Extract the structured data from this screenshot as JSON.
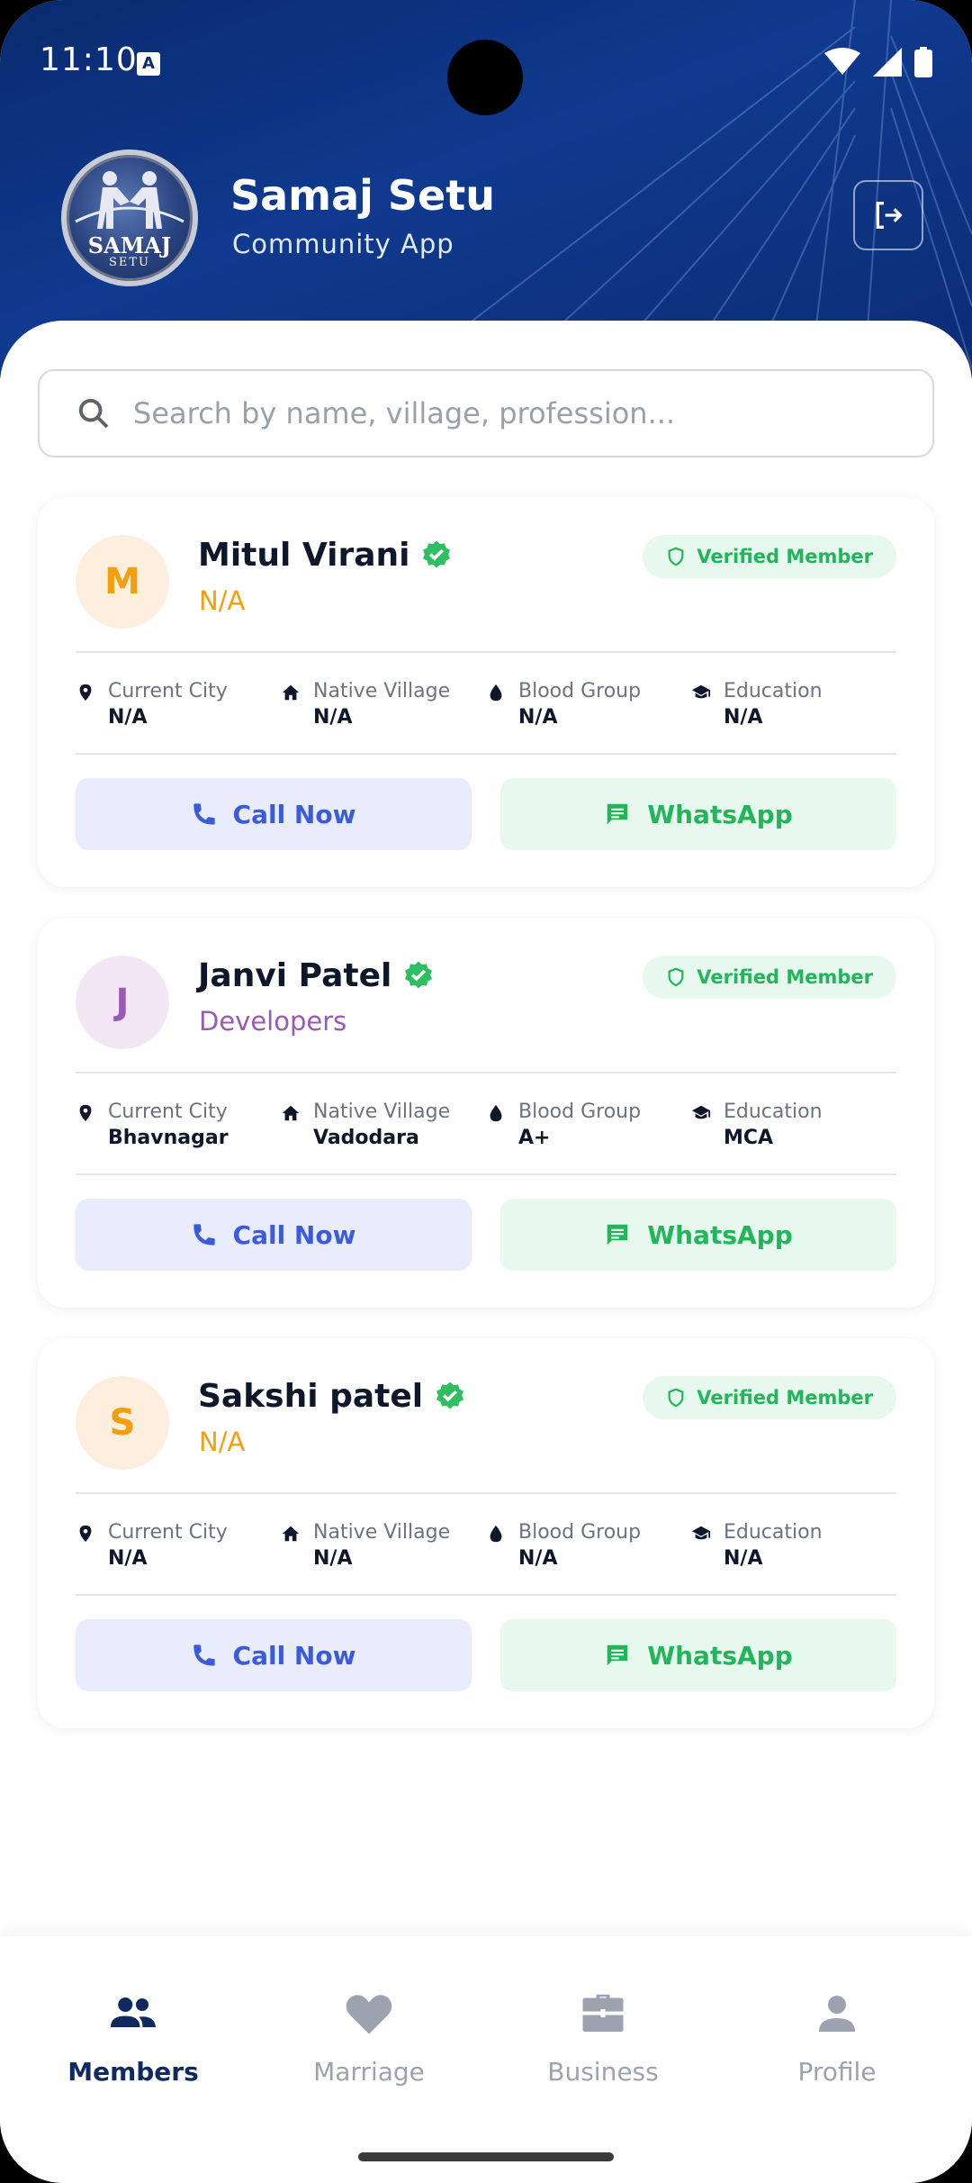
{
  "status_bar": {
    "time": "11:10",
    "a_icon": "A"
  },
  "header": {
    "logo_text_main": "SAMAJ",
    "logo_text_sub": "SETU",
    "title": "Samaj Setu",
    "subtitle": "Community App"
  },
  "search": {
    "placeholder": "Search by name, village, profession..."
  },
  "labels": {
    "current_city": "Current City",
    "native_village": "Native Village",
    "blood_group": "Blood Group",
    "education": "Education",
    "verified": "Verified Member",
    "call": "Call Now",
    "whatsapp": "WhatsApp"
  },
  "members": [
    {
      "initial": "M",
      "name": "Mitul Virani",
      "profession": "N/A",
      "current_city": "N/A",
      "native_village": "N/A",
      "blood_group": "N/A",
      "education": "N/A",
      "avatar_bg": "#fdeedd",
      "avatar_fg": "#f59e0b",
      "profession_color": "#f59e0b"
    },
    {
      "initial": "J",
      "name": "Janvi Patel",
      "profession": "Developers",
      "current_city": "Bhavnagar",
      "native_village": "Vadodara",
      "blood_group": "A+",
      "education": "MCA",
      "avatar_bg": "#f3e6f5",
      "avatar_fg": "#9b59b6",
      "profession_color": "#9b59b6"
    },
    {
      "initial": "S",
      "name": "Sakshi patel",
      "profession": "N/A",
      "current_city": "N/A",
      "native_village": "N/A",
      "blood_group": "N/A",
      "education": "N/A",
      "avatar_bg": "#fdeedd",
      "avatar_fg": "#f59e0b",
      "profession_color": "#f59e0b"
    }
  ],
  "bottom_nav": [
    {
      "label": "Members",
      "icon": "people-icon",
      "active": true
    },
    {
      "label": "Marriage",
      "icon": "heart-icon",
      "active": false
    },
    {
      "label": "Business",
      "icon": "briefcase-icon",
      "active": false
    },
    {
      "label": "Profile",
      "icon": "person-icon",
      "active": false
    }
  ],
  "colors": {
    "header_bg": "#0c2c72",
    "verified_green": "#22b55a",
    "call_blue": "#3b5bdb",
    "nav_active": "#0f2a5e"
  }
}
